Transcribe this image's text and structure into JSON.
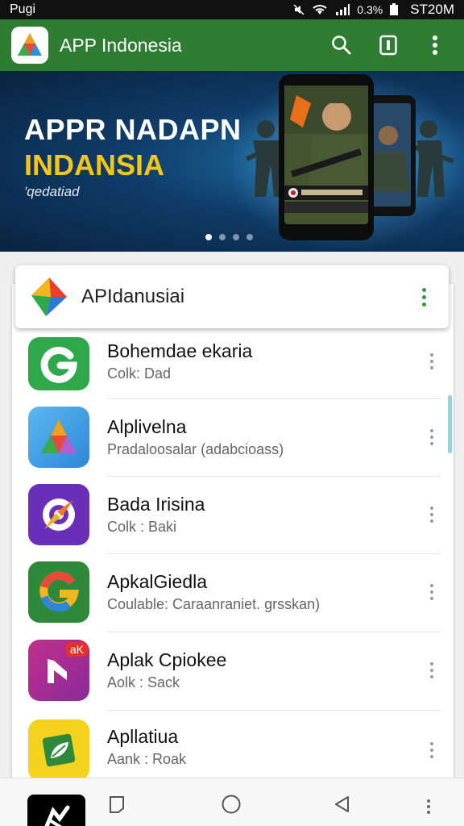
{
  "status_bar": {
    "left_text": "Pugi",
    "battery": "0.3%",
    "time": "ST20M"
  },
  "app_bar": {
    "title": "APP Indonesia",
    "icons": [
      "app-logo-icon",
      "search-icon",
      "bookmark-icon",
      "more-vertical-icon"
    ]
  },
  "banner": {
    "title_line1": "APPR NADAPN",
    "title_line2": "INDANSIA",
    "subtitle": "'qedatiad",
    "slides_total": 4,
    "active_slide": 1
  },
  "search_card": {
    "title": "APIdanusiai",
    "icon": "prism-logo-icon"
  },
  "apps": [
    {
      "name": "Bohemdae ekaria",
      "sub": "Colk: Dad",
      "icon": "g-logo-green-icon"
    },
    {
      "name": "Alplivelna",
      "sub": "Pradaloosalar (adabcioass)",
      "icon": "triangle-logo-icon"
    },
    {
      "name": "Bada Irisina",
      "sub": "Colk : Baki",
      "icon": "compass-logo-icon"
    },
    {
      "name": "ApkalGiedla",
      "sub": "Coulable: Caraanraniet. grsskan)",
      "icon": "g-logo-color-icon"
    },
    {
      "name": "Aplak Cpiokee",
      "sub": "Aolk : Sack",
      "icon": "play-badge-icon",
      "badge": "aK"
    },
    {
      "name": "Apllatiua",
      "sub": "Aank : Roak",
      "icon": "leaf-card-icon"
    }
  ],
  "nav_bar": {
    "icons": [
      "app-shortcut-icon",
      "square-nav-icon",
      "home-circle-icon",
      "back-triangle-icon",
      "more-vertical-icon"
    ]
  },
  "colors": {
    "app_bar": "#2e7d32",
    "status_bar": "#111111",
    "banner_title_accent": "#f5c518"
  }
}
